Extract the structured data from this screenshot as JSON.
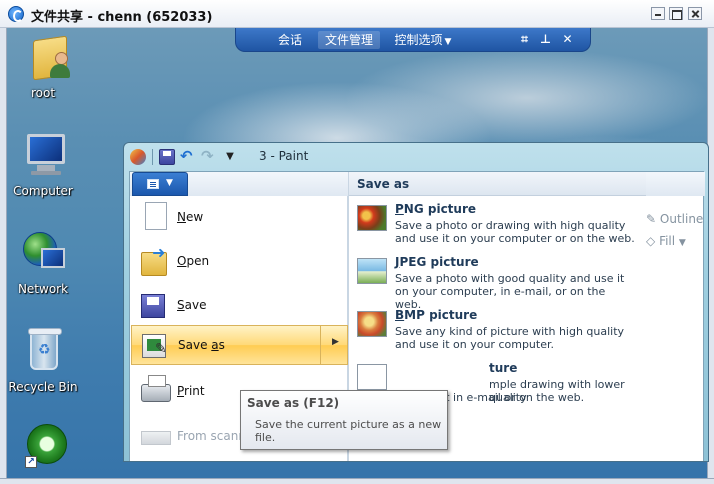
{
  "outer_window": {
    "title": "文件共享 - chenn (652033)"
  },
  "remote_bar": {
    "tabs": [
      "会话",
      "文件管理",
      "控制选项"
    ],
    "active_tab": "文件管理",
    "icons": [
      "fullscreen-icon",
      "pin-icon",
      "close-icon"
    ]
  },
  "desktop_icons": [
    {
      "label": "root",
      "icon": "user-folder-icon"
    },
    {
      "label": "Computer",
      "icon": "computer-icon"
    },
    {
      "label": "Network",
      "icon": "network-icon"
    },
    {
      "label": "Recycle Bin",
      "icon": "recycle-bin-icon"
    },
    {
      "label": "",
      "icon": "app-shortcut-icon"
    }
  ],
  "paint": {
    "title": "3 - Paint",
    "ribbon_right": [
      "Outline",
      "Fill"
    ],
    "menu": {
      "items": [
        {
          "label": "New",
          "accel": "N",
          "rest": "ew",
          "icon": "new-page-icon",
          "enabled": true
        },
        {
          "label": "Open",
          "accel": "O",
          "rest": "pen",
          "icon": "open-folder-icon",
          "enabled": true
        },
        {
          "label": "Save",
          "accel": "S",
          "rest": "ave",
          "icon": "save-icon",
          "enabled": true
        },
        {
          "label": "Save as",
          "pre": "Save ",
          "accel": "a",
          "rest": "s",
          "icon": "save-as-icon",
          "enabled": true,
          "highlighted": true
        },
        {
          "label": "Print",
          "accel": "P",
          "rest": "rint",
          "icon": "printer-icon",
          "enabled": true
        },
        {
          "label": "From scanner or camera",
          "icon": "scanner-icon",
          "enabled": false
        }
      ]
    },
    "save_as": {
      "header": "Save as",
      "options": [
        {
          "accel": "P",
          "rest": "NG picture",
          "desc": "Save a photo or drawing with high quality and use it on your computer or on the web."
        },
        {
          "accel": "J",
          "rest": "PEG picture",
          "desc": "Save a photo with good quality and use it on your computer, in e-mail, or on the web."
        },
        {
          "accel": "B",
          "rest": "MP picture",
          "desc": "Save any kind of picture with high quality and use it on your computer."
        },
        {
          "title_tail": "ture",
          "desc_line1": "mple drawing with lower quality",
          "desc_line2": "and use it in e-mail or on the web."
        }
      ]
    },
    "tooltip": {
      "title": "Save as (F12)",
      "body": "Save the current picture as a new file."
    }
  },
  "colors": {
    "remote_bar": "#2a62b3",
    "highlight": "#ffd978",
    "paint_frame": "#9fcfe0"
  }
}
